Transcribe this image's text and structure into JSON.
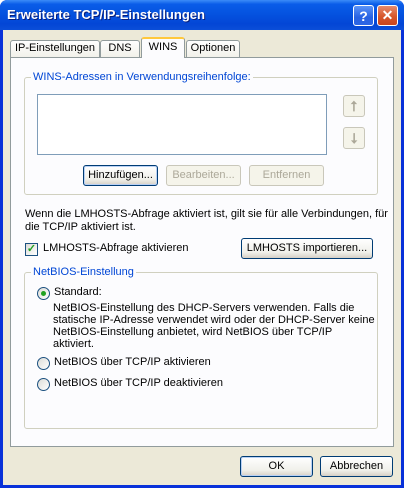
{
  "window": {
    "title": "Erweiterte TCP/IP-Einstellungen"
  },
  "titlebar": {
    "help_glyph": "?",
    "close_glyph": "✕"
  },
  "tabs": [
    {
      "label": "IP-Einstellungen",
      "active": false
    },
    {
      "label": "DNS",
      "active": false
    },
    {
      "label": "WINS",
      "active": true
    },
    {
      "label": "Optionen",
      "active": false
    }
  ],
  "wins": {
    "group_label": "WINS-Adressen in Verwendungsreihenfolge:",
    "up_glyph": "⭡",
    "down_glyph": "⭣",
    "add_button": "Hinzufügen...",
    "edit_button": "Bearbeiten...",
    "remove_button": "Entfernen"
  },
  "lmhosts": {
    "info_line1": "Wenn die LMHOSTS-Abfrage aktiviert ist, gilt sie für alle Verbindungen, für",
    "info_line2": "die TCP/IP aktiviert ist.",
    "checkbox_label": "LMHOSTS-Abfrage aktivieren",
    "checked": true,
    "import_button": "LMHOSTS importieren..."
  },
  "netbios": {
    "group_label": "NetBIOS-Einstellung",
    "selected": "standard",
    "option_standard": "Standard:",
    "standard_desc_line1": "NetBIOS-Einstellung des DHCP-Servers verwenden. Falls die",
    "standard_desc_line2": "statische IP-Adresse verwendet wird oder der DHCP-Server keine",
    "standard_desc_line3": "NetBIOS-Einstellung anbietet, wird NetBIOS über TCP/IP",
    "standard_desc_line4": "aktiviert.",
    "option_enable": "NetBIOS über TCP/IP aktivieren",
    "option_disable": "NetBIOS über TCP/IP deaktivieren"
  },
  "footer": {
    "ok_button": "OK",
    "cancel_button": "Abbrechen"
  }
}
